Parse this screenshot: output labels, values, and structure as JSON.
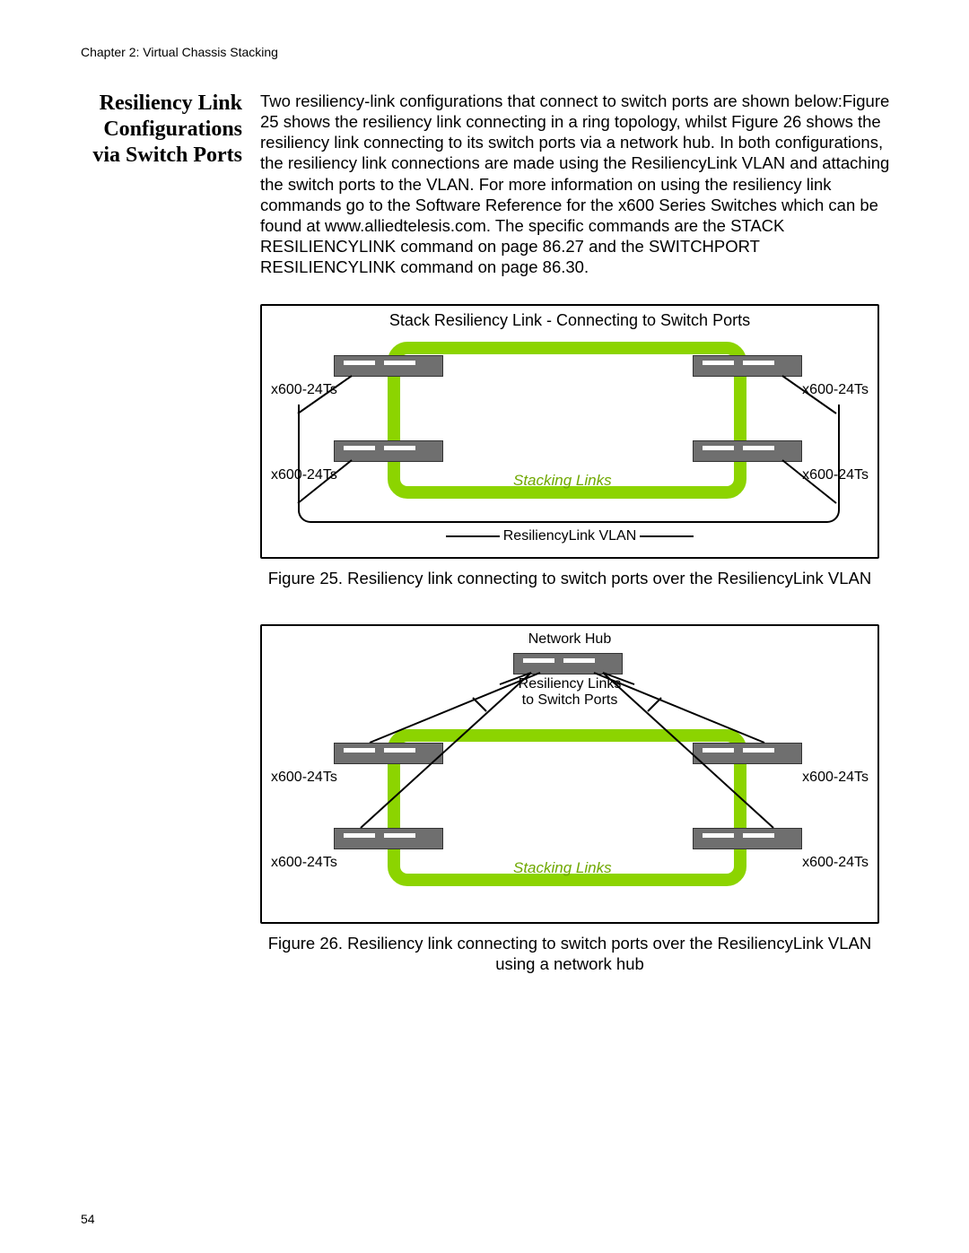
{
  "page": {
    "chapter_header": "Chapter 2: Virtual Chassis Stacking",
    "page_number": "54"
  },
  "heading": "Resiliency Link Configurations via Switch Ports",
  "body_paragraph": "Two resiliency-link configurations that connect to switch ports are shown below:Figure 25 shows the resiliency link connecting in a ring topology, whilst Figure 26 shows the resiliency link connecting to its switch ports via a network hub. In both configurations, the resiliency link connections are made using the ResiliencyLink VLAN and attaching the switch ports to the VLAN. For more information on using the resiliency link commands go to the Software Reference for the x600 Series Switches which can be found at www.alliedtelesis.com. The specific commands are the STACK RESILIENCYLINK command on page 86.27 and the SWITCHPORT RESILIENCYLINK command on page 86.30.",
  "figure25": {
    "title": "Stack Resiliency Link - Connecting to Switch Ports",
    "switch_label": "x600-24Ts",
    "stacking_label": "Stacking Links",
    "vlan_label": "ResiliencyLink VLAN",
    "caption": "Figure 25. Resiliency link connecting to switch ports over the ResiliencyLink VLAN"
  },
  "figure26": {
    "hub_label": "Network Hub",
    "links_label_line1": "Resiliency Links",
    "links_label_line2": "to Switch Ports",
    "switch_label": "x600-24Ts",
    "stacking_label": "Stacking Links",
    "caption": "Figure 26. Resiliency link connecting to switch ports over the ResiliencyLink VLAN using a network hub"
  }
}
